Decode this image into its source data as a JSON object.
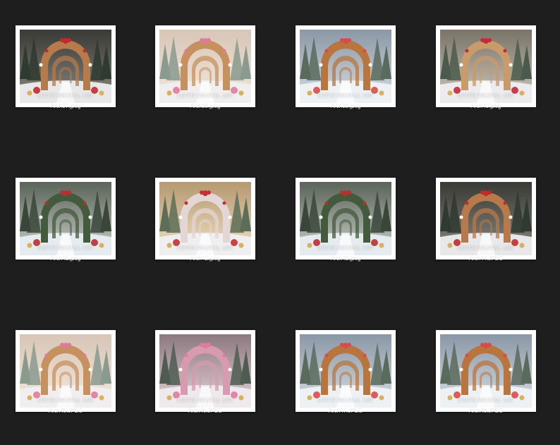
{
  "watermark_text": "EDITH DIGITAL ART",
  "files": [
    {
      "name": "Arch37.jpeg",
      "theme": "dark-forest-red"
    },
    {
      "name": "Arch38.jpeg",
      "theme": "pink-sunburst"
    },
    {
      "name": "Arch39.jpeg",
      "theme": "snowy-gingerbread"
    },
    {
      "name": "Arch40.jpeg",
      "theme": "red-bows"
    },
    {
      "name": "Arch41.jpeg",
      "theme": "wreath-forest"
    },
    {
      "name": "Arch42.jpeg",
      "theme": "candy-cane-sunny"
    },
    {
      "name": "Arch43.jpeg",
      "theme": "wreath-forest"
    },
    {
      "name": "Arch44.JPEG",
      "theme": "dark-forest-red"
    },
    {
      "name": "Arch45.JPEG",
      "theme": "pink-sunburst"
    },
    {
      "name": "Arch46.JPEG",
      "theme": "pink-forest"
    },
    {
      "name": "Arch47.JPEG",
      "theme": "snowy-gingerbread"
    },
    {
      "name": "Arch48.JPEG",
      "theme": "snowy-gingerbread"
    }
  ],
  "colors": {
    "background": "#1e1e1e",
    "thumb_border": "#ffffff",
    "label": "#e6e6e6"
  }
}
